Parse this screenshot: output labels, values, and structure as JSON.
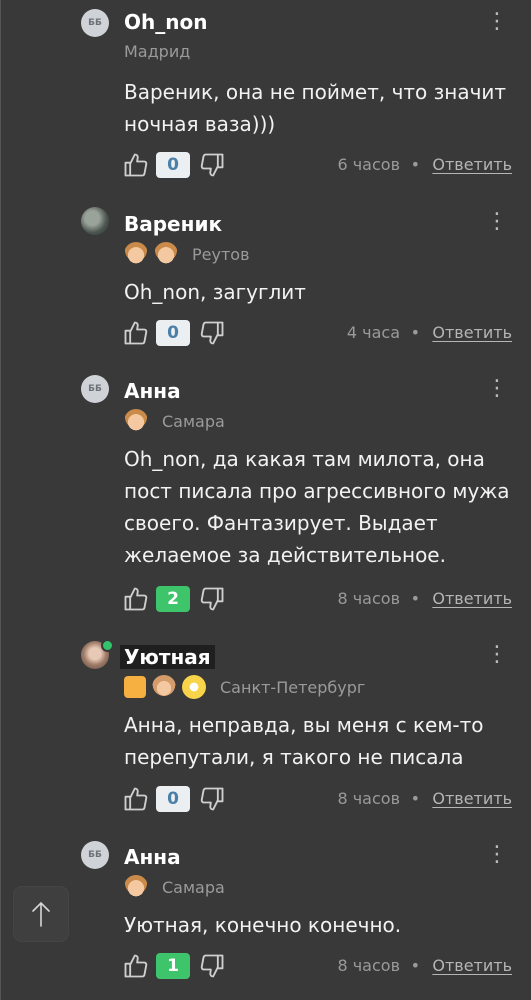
{
  "comments": [
    {
      "author": "Oh_non",
      "avatar_text": "ББ",
      "city": "Мадрид",
      "text": "Вареник, она не поймет, что значит ночная ваза)))",
      "rating": "0",
      "time": "6 часов",
      "reply_label": "Ответить"
    },
    {
      "author": "Вареник",
      "city": "Реутов",
      "badges": [
        "boy-face-icon",
        "boy-face-icon"
      ],
      "text": "Oh_non, загуглит",
      "rating": "0",
      "time": "4 часа",
      "reply_label": "Ответить"
    },
    {
      "author": "Анна",
      "avatar_text": "ББ",
      "city": "Самара",
      "badges": [
        "boy-face-icon"
      ],
      "text": "Oh_non, да какая там милота, она пост писала про агрессивного мужа своего. Фантазирует. Выдает желаемое за действительное.",
      "rating": "2",
      "time": "8 часов",
      "reply_label": "Ответить"
    },
    {
      "author": "Уютная",
      "city": "Санкт-Петербург",
      "badges": [
        "orange-square-icon",
        "girl-face-icon",
        "sun-icon"
      ],
      "text": "Анна, неправда, вы меня с кем-то перепутали, я такого не писала",
      "rating": "0",
      "time": "8 часов",
      "reply_label": "Ответить"
    },
    {
      "author": "Анна",
      "avatar_text": "ББ",
      "city": "Самара",
      "badges": [
        "boy-face-icon"
      ],
      "text": "Уютная, конечно конечно.",
      "rating": "1",
      "time": "8 часов",
      "reply_label": "Ответить"
    }
  ],
  "separator": "•",
  "menu_icon": "kebab-menu-icon",
  "colors": {
    "background": "#393939",
    "positive": "#3ec56b",
    "zero_badge": "#eceff2",
    "online": "#33c46b"
  }
}
